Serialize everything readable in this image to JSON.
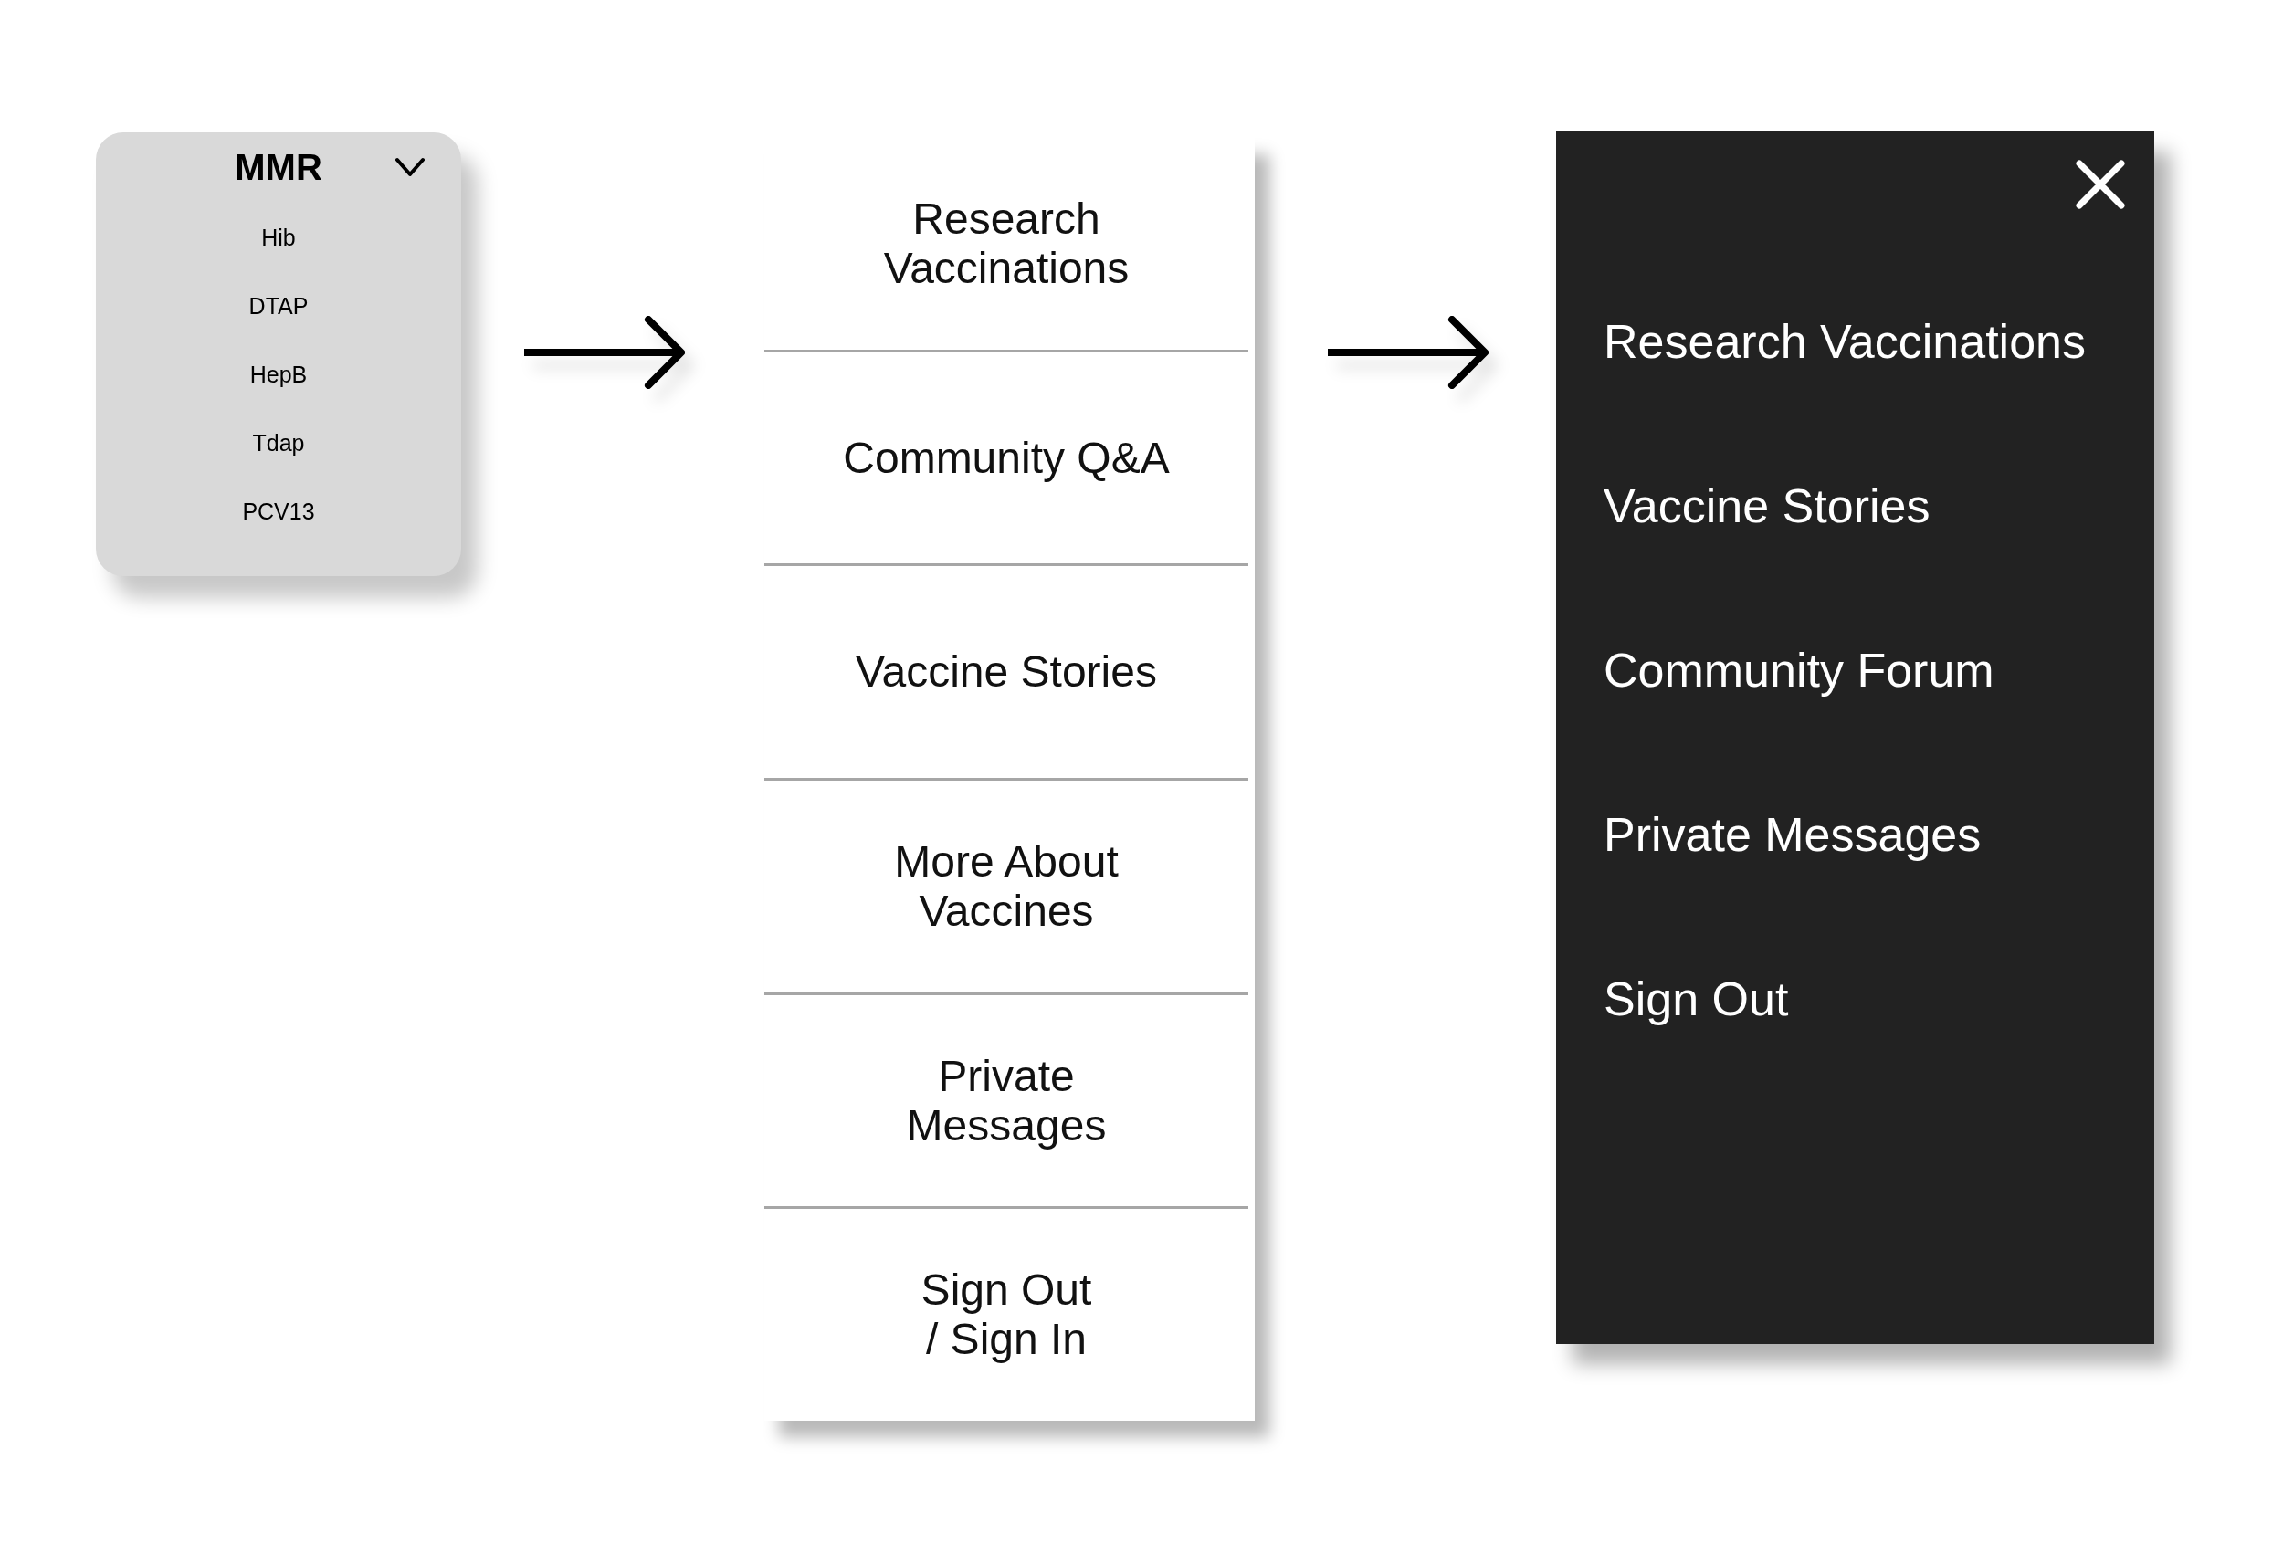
{
  "dropdown": {
    "value": "MMR",
    "options": [
      "Hib",
      "DTAP",
      "HepB",
      "Tdap",
      "PCV13"
    ]
  },
  "mobile_menu": {
    "items": [
      {
        "lines": [
          "Research",
          "Vaccinations"
        ]
      },
      {
        "lines": [
          "Community Q&A"
        ]
      },
      {
        "lines": [
          "Vaccine Stories"
        ]
      },
      {
        "lines": [
          "More About",
          "Vaccines"
        ]
      },
      {
        "lines": [
          "Private",
          "Messages"
        ]
      },
      {
        "lines": [
          "Sign Out",
          "/ Sign In"
        ]
      }
    ]
  },
  "side_drawer": {
    "items": [
      "Research Vaccinations",
      "Vaccine Stories",
      "Community Forum",
      "Private Messages",
      "Sign Out"
    ]
  }
}
